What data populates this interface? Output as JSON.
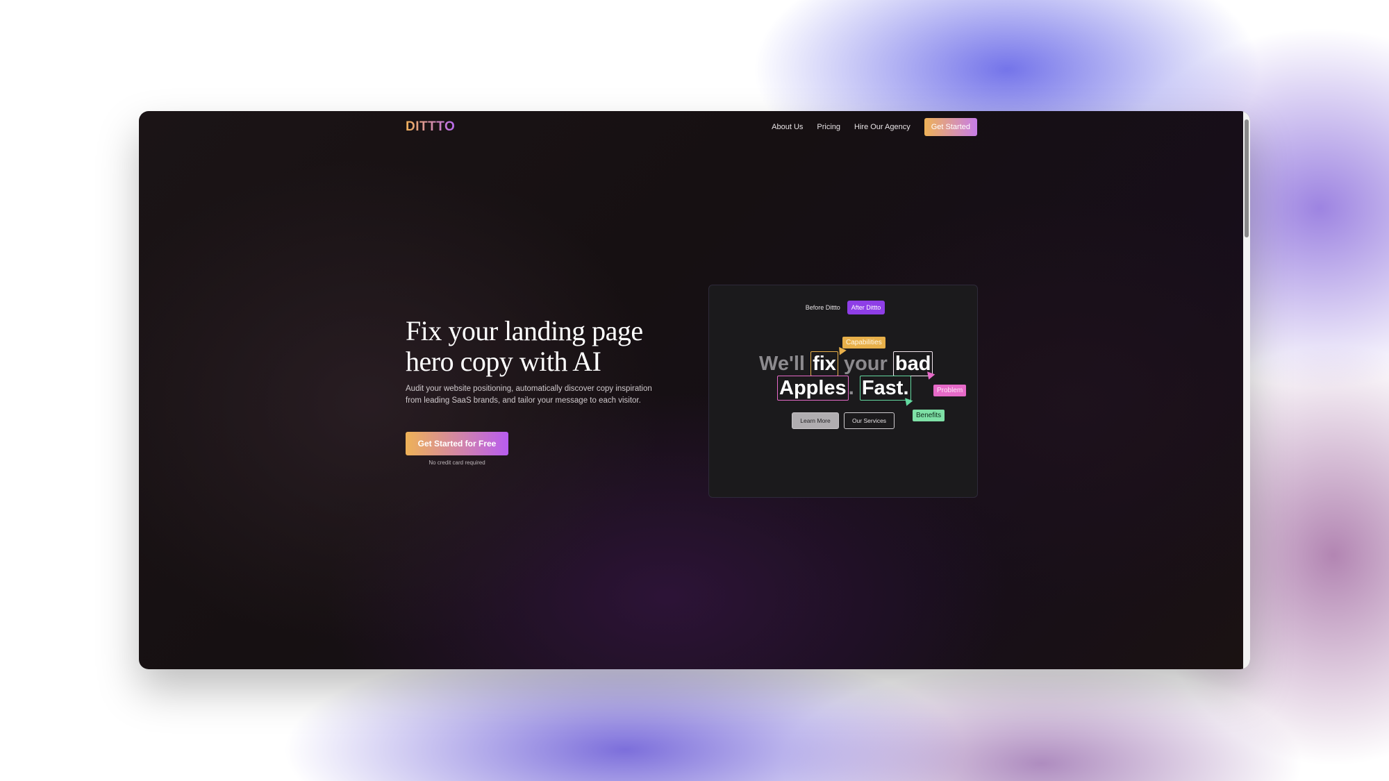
{
  "nav": {
    "logo": "DITTTO",
    "links": [
      "About Us",
      "Pricing",
      "Hire Our Agency"
    ],
    "cta": "Get Started"
  },
  "hero": {
    "title_line1": "Fix your landing page",
    "title_line2": "hero copy with AI",
    "subtitle": "Audit your website positioning, automatically discover copy inspiration from leading SaaS brands, and tailor your message to each visitor.",
    "cta": "Get Started for Free",
    "note": "No credit card required"
  },
  "preview": {
    "toggles": [
      "Before Dittto",
      "After Dittto"
    ],
    "active_toggle": "After Dittto",
    "headline": {
      "w1": "We'll",
      "w2": "fix",
      "w3": "your",
      "w4": "bad",
      "w5": "Apples",
      "w6": ".",
      "w7": "Fast."
    },
    "tags": {
      "capabilities": "Capabilities",
      "problem": "Problem",
      "benefits": "Benefits"
    },
    "buttons": {
      "learn_more": "Learn More",
      "our_services": "Our Services"
    }
  },
  "colors": {
    "brand_gold": "#eeb257",
    "brand_purple": "#b85cf0",
    "capabilities_tag": "#e8b04a",
    "problem_tag": "#e66ac8",
    "benefits_tag": "#7ee0a6"
  }
}
